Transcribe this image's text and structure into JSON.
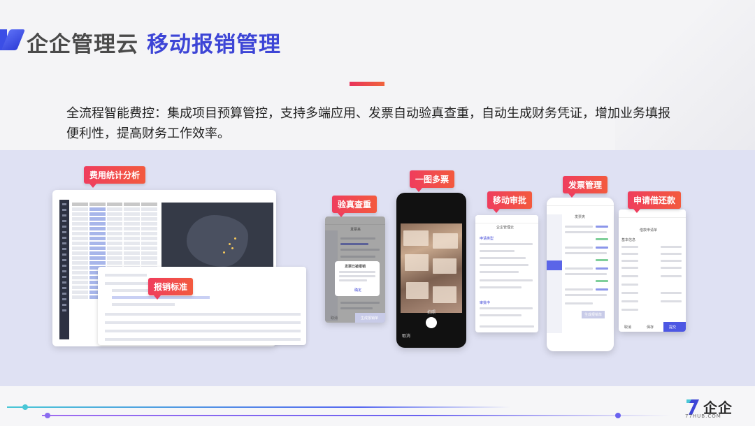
{
  "header": {
    "title_main": "企企管理云",
    "title_sub": "移动报销管理",
    "description": "全流程智能费控：集成项目预算管控，支持多端应用、发票自动验真查重，自动生成财务凭证，增加业务填报便利性，提高财务工作效率。"
  },
  "labels": {
    "expense_analysis": "费用统计分析",
    "reimbursement_standard": "报销标准",
    "verify_check": "验真查重",
    "multi_invoice": "一图多票",
    "mobile_approval": "移动审批",
    "invoice_management": "发票管理",
    "loan_repayment": "申请借还款"
  },
  "screens": {
    "verify_title": "发票夹",
    "verify_dialog_title": "发票已被报销",
    "verify_dialog_btn": "确定",
    "verify_btn_left": "取消",
    "verify_btn_right": "生成报销单",
    "camera_left": "取消",
    "camera_center": "拍照",
    "approval_title": "企企管理云",
    "approval_field1": "申请类型",
    "approval_field2": "审批中",
    "invoice_title": "发票夹",
    "invoice_btn": "生成报销单",
    "loan_title": "借款申请单",
    "loan_field1": "基本信息",
    "loan_btn_left": "取消",
    "loan_btn_mid": "保存",
    "loan_btn_right": "提交"
  },
  "brand": {
    "name": "企企",
    "url": "77HUB.COM"
  },
  "colors": {
    "accent_blue": "#3d45d6",
    "tag_red": "#ef3d5d",
    "band": "#dfe1f3"
  }
}
